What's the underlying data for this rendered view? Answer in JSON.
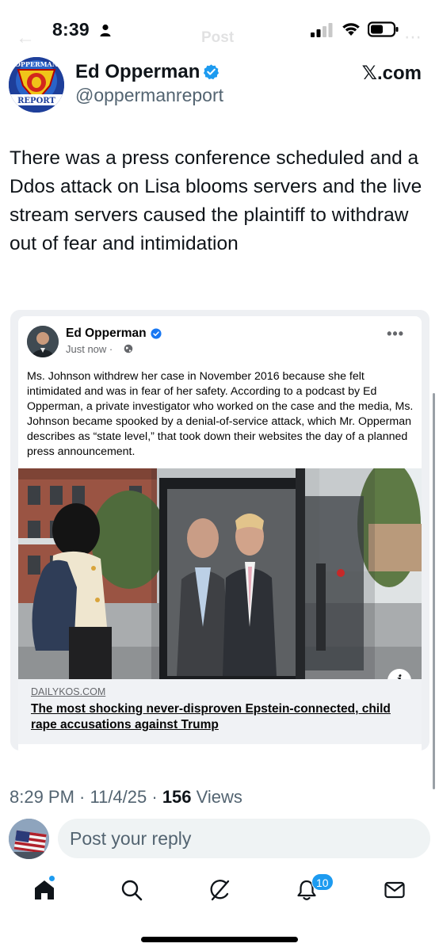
{
  "status_bar": {
    "time": "8:39"
  },
  "ghost_nav": {
    "back": "←",
    "title": "Post",
    "more": "⋯"
  },
  "post": {
    "author_name": "Ed Opperman",
    "author_handle": "@oppermanreport",
    "source": "𝕏.com",
    "avatar_text_top": "OPPERMAN",
    "avatar_text_bottom": "REPORT",
    "text": "There was a press conference scheduled and a Ddos attack on Lisa blooms servers and the live stream servers caused the plaintiff to withdraw out of fear and intimidation",
    "posted_time": "8:29 PM · 11/4/25 · ",
    "views_count": "156",
    "views_label": " Views"
  },
  "embed": {
    "name": "Ed Opperman",
    "timestamp": "Just now ·",
    "more": "•••",
    "body": "Ms. Johnson withdrew her case in November 2016 because she felt intimidated and was in fear of her safety. According to a podcast by Ed Opperman, a private investigator who worked on the case and the media, Ms. Johnson became spooked by a denial-of-service attack, which Mr. Opperman describes as “state level,” that took down their websites the day of a planned press announcement.",
    "info_glyph": "i",
    "link_domain": "DAILYKOS.COM",
    "link_title": "The most shocking never-disproven Epstein-connected, child rape accusations against Trump"
  },
  "reply": {
    "placeholder": "Post your reply"
  },
  "tabbar": {
    "items": [
      "home-icon",
      "search-icon",
      "grok-icon",
      "notifications-icon",
      "messages-icon"
    ],
    "notification_count": "10"
  },
  "colors": {
    "x_blue": "#1d9bf0",
    "muted_text": "#536471",
    "fb_blue": "#1877f2"
  }
}
